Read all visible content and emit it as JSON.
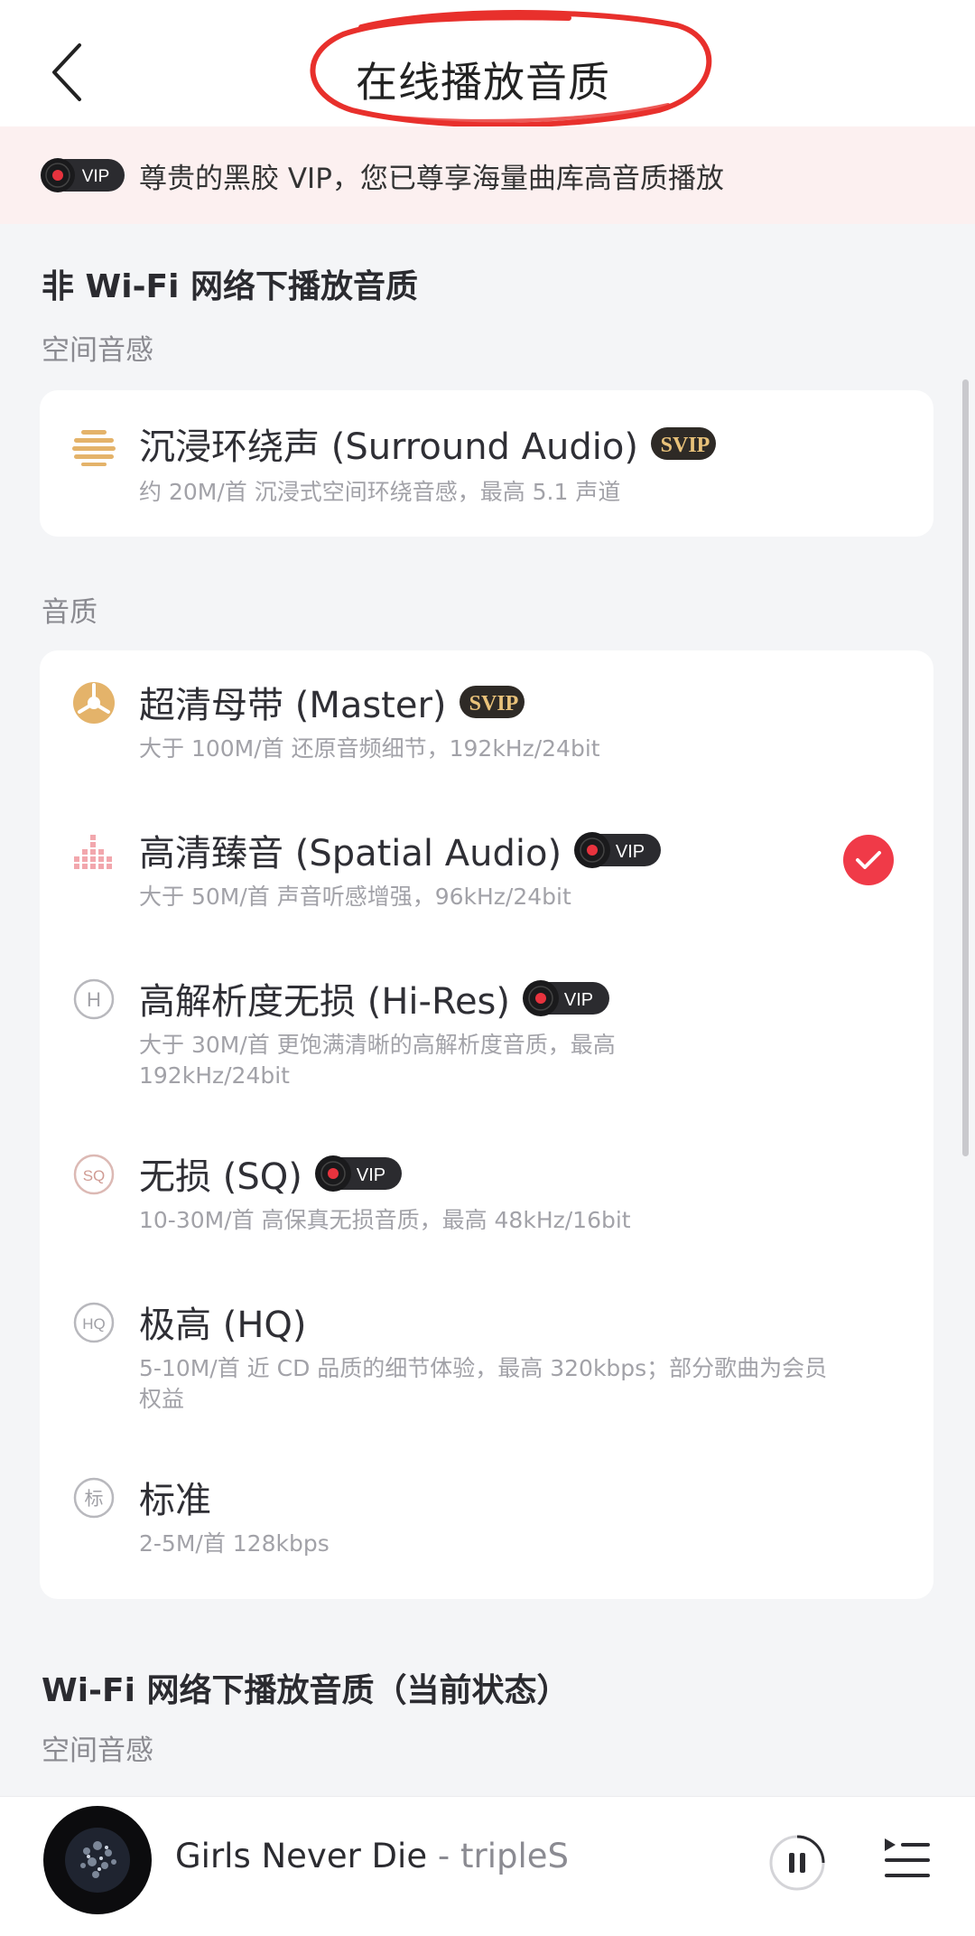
{
  "header": {
    "title": "在线播放音质"
  },
  "vip_banner": {
    "badge": "VIP",
    "text": "尊贵的黑胶 VIP，您已尊享海量曲库高音质播放"
  },
  "sections": [
    {
      "title": "非 Wi-Fi 网络下播放音质",
      "spatial_label": "空间音感",
      "spatial_items": [
        {
          "title": "沉浸环绕声 (Surround Audio)",
          "badge": "SVIP",
          "desc": "约 20M/首  沉浸式空间环绕音感，最高 5.1 声道",
          "icon": "surround-icon"
        }
      ],
      "quality_label": "音质",
      "quality_items": [
        {
          "title": "超清母带 (Master)",
          "badge": "SVIP",
          "desc": "大于 100M/首  还原音频细节，192kHz/24bit",
          "icon": "master-icon",
          "selected": false
        },
        {
          "title": "高清臻音 (Spatial Audio)",
          "badge": "VIP",
          "desc": "大于 50M/首  声音听感增强，96kHz/24bit",
          "icon": "spatial-audio-icon",
          "selected": true
        },
        {
          "title": "高解析度无损 (Hi-Res)",
          "badge": "VIP",
          "desc": "大于 30M/首  更饱满清晰的高解析度音质，最高 192kHz/24bit",
          "icon": "hi-res-icon",
          "icon_text": "H",
          "selected": false
        },
        {
          "title": "无损 (SQ)",
          "badge": "VIP",
          "desc": "10-30M/首  高保真无损音质，最高 48kHz/16bit",
          "icon": "sq-icon",
          "icon_text": "SQ",
          "selected": false
        },
        {
          "title": "极高 (HQ)",
          "badge": "",
          "desc": "5-10M/首  近 CD 品质的细节体验，最高 320kbps；部分歌曲为会员权益",
          "icon": "hq-icon",
          "icon_text": "HQ",
          "selected": false
        },
        {
          "title": "标准",
          "badge": "",
          "desc": "2-5M/首  128kbps",
          "icon": "standard-icon",
          "icon_text": "标",
          "selected": false
        }
      ]
    },
    {
      "title": "Wi-Fi 网络下播放音质（当前状态）",
      "spatial_label": "空间音感"
    }
  ],
  "player": {
    "song": "Girls Never Die",
    "separator": " - ",
    "artist": "tripleS"
  },
  "colors": {
    "accent_red": "#f03a48",
    "gold": "#d9a65a",
    "banner_bg": "#fcf0f0"
  }
}
